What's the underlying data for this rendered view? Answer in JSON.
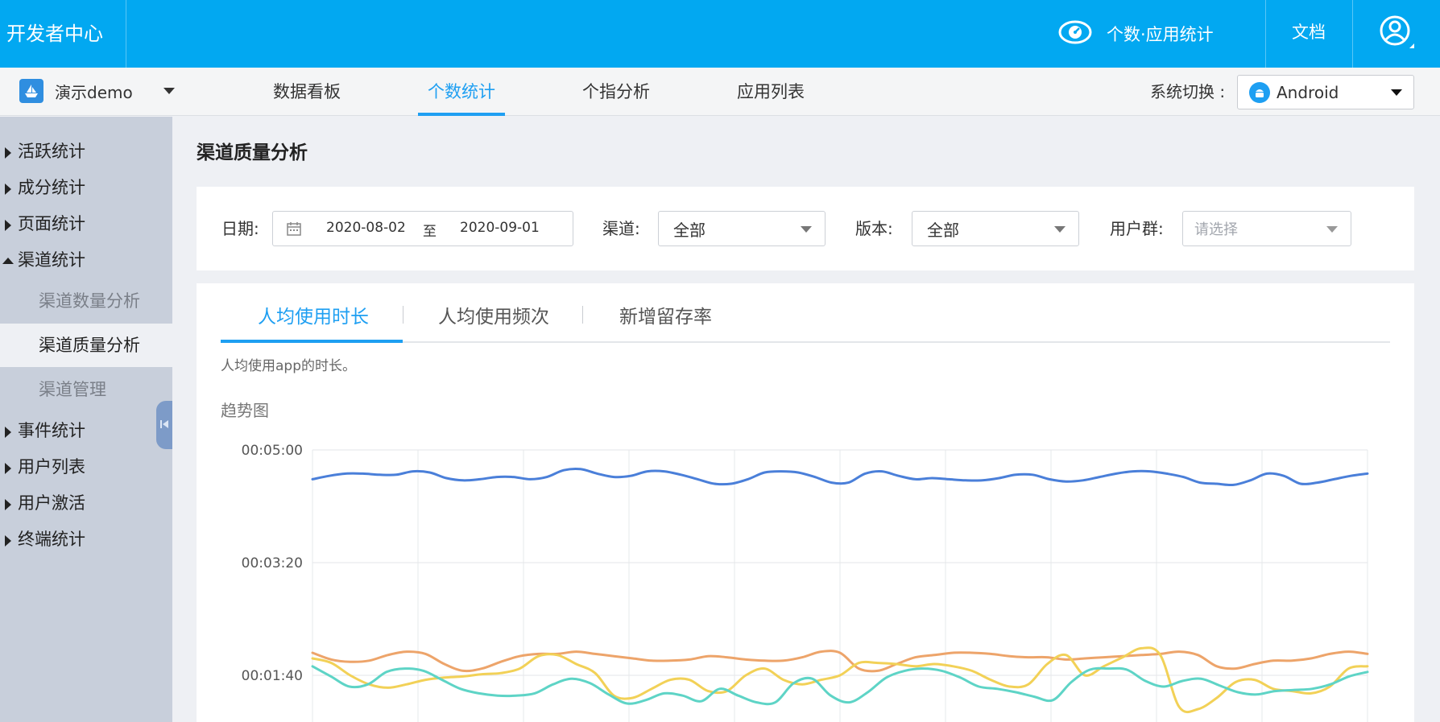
{
  "header": {
    "brand": "开发者中心",
    "stat_label": "个数·应用统计",
    "docs_label": "文档"
  },
  "subnav": {
    "app_name": "演示demo",
    "tabs": [
      {
        "label": "数据看板",
        "active": false
      },
      {
        "label": "个数统计",
        "active": true
      },
      {
        "label": "个指分析",
        "active": false
      },
      {
        "label": "应用列表",
        "active": false
      }
    ],
    "system_label": "系统切换 :",
    "system_value": "Android"
  },
  "sidebar": {
    "items": [
      {
        "label": "活跃统计",
        "expanded": false
      },
      {
        "label": "成分统计",
        "expanded": false
      },
      {
        "label": "页面统计",
        "expanded": false
      },
      {
        "label": "渠道统计",
        "expanded": true
      },
      {
        "label": "事件统计",
        "expanded": false
      },
      {
        "label": "用户列表",
        "expanded": false
      },
      {
        "label": "用户激活",
        "expanded": false
      },
      {
        "label": "终端统计",
        "expanded": false
      }
    ],
    "sub_items": [
      {
        "label": "渠道数量分析",
        "active": false
      },
      {
        "label": "渠道质量分析",
        "active": true
      },
      {
        "label": "渠道管理",
        "active": false
      }
    ]
  },
  "main": {
    "page_title": "渠道质量分析",
    "filters": {
      "date_label": "日期:",
      "date_from": "2020-08-02",
      "date_sep": "至",
      "date_to": "2020-09-01",
      "channel_label": "渠道:",
      "channel_value": "全部",
      "version_label": "版本:",
      "version_value": "全部",
      "group_label": "用户群:",
      "group_placeholder": "请选择"
    },
    "tabs": [
      {
        "label": "人均使用时长",
        "active": true
      },
      {
        "label": "人均使用频次",
        "active": false
      },
      {
        "label": "新增留存率",
        "active": false
      }
    ],
    "tab_description": "人均使用app的时长。",
    "trend_title": "趋势图"
  },
  "chart_data": {
    "type": "line",
    "title": "",
    "xlabel": "",
    "ylabel": "",
    "y_unit": "seconds",
    "y_ticks": [
      {
        "value": 100,
        "label": "00:01:40"
      },
      {
        "value": 200,
        "label": "00:03:20"
      },
      {
        "value": 300,
        "label": "00:05:00"
      }
    ],
    "ylim": [
      0,
      300
    ],
    "grid": true,
    "x_count": 47,
    "series": [
      {
        "color": "#4a7fd9",
        "values": [
          274,
          277,
          279,
          279,
          278,
          278,
          281,
          280,
          275,
          273,
          274,
          276,
          276,
          274,
          276,
          282,
          283,
          279,
          276,
          277,
          281,
          281,
          278,
          274,
          270,
          270,
          274,
          280,
          281,
          280,
          276,
          271,
          271,
          279,
          281,
          277,
          274,
          275,
          274,
          273,
          273,
          275,
          278,
          278,
          274,
          272,
          273,
          276,
          279,
          281,
          281,
          279,
          276,
          271,
          270,
          269,
          273,
          279,
          277,
          270,
          271,
          274,
          277,
          279
        ]
      },
      {
        "color": "#eda46a",
        "values": [
          120,
          114,
          112,
          113,
          118,
          121,
          119,
          110,
          104,
          106,
          112,
          117,
          119,
          119,
          121,
          119,
          117,
          115,
          113,
          113,
          114,
          117,
          116,
          114,
          113,
          113,
          116,
          121,
          120,
          106,
          104,
          110,
          116,
          118,
          120,
          120,
          119,
          117,
          116,
          116,
          114,
          115,
          116,
          117,
          118,
          119,
          121,
          118,
          108,
          106,
          110,
          113,
          113,
          115,
          119,
          121,
          119
        ]
      },
      {
        "color": "#f2d157",
        "values": [
          115,
          111,
          100,
          92,
          89,
          92,
          96,
          98,
          99,
          101,
          102,
          106,
          117,
          118,
          110,
          102,
          82,
          80,
          88,
          96,
          96,
          86,
          86,
          100,
          106,
          96,
          92,
          96,
          100,
          111,
          111,
          110,
          108,
          110,
          108,
          104,
          96,
          90,
          92,
          110,
          118,
          100,
          108,
          116,
          124,
          118,
          72,
          70,
          80,
          94,
          96,
          88,
          86,
          84,
          90,
          106,
          108
        ]
      },
      {
        "color": "#5ed4c6",
        "values": [
          108,
          99,
          90,
          92,
          103,
          106,
          104,
          96,
          88,
          84,
          82,
          82,
          84,
          92,
          97,
          93,
          83,
          75,
          78,
          84,
          82,
          77,
          88,
          82,
          76,
          76,
          93,
          97,
          82,
          76,
          85,
          98,
          104,
          106,
          104,
          98,
          90,
          88,
          85,
          81,
          78,
          94,
          105,
          106,
          105,
          95,
          90,
          95,
          97,
          91,
          85,
          83,
          86,
          87,
          88,
          92,
          99,
          103
        ]
      }
    ]
  }
}
